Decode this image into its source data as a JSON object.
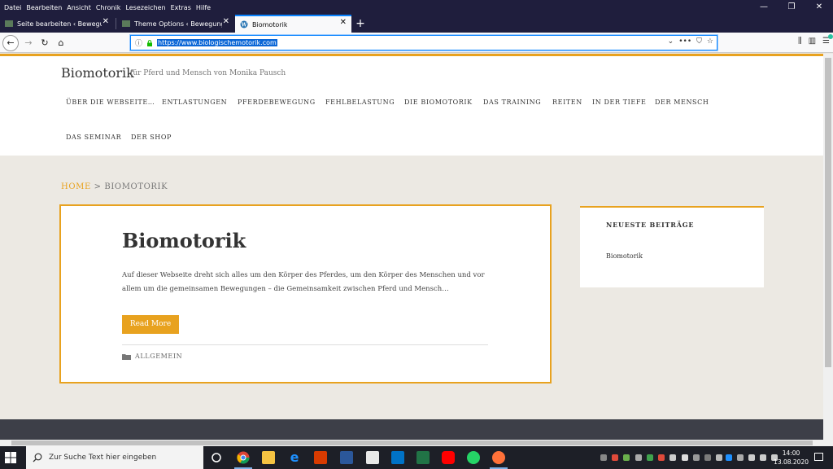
{
  "menubar": {
    "items": [
      "Datei",
      "Bearbeiten",
      "Ansicht",
      "Chronik",
      "Lesezeichen",
      "Extras",
      "Hilfe"
    ]
  },
  "window_controls": {
    "minimize": "—",
    "restore": "❐",
    "close": "✕"
  },
  "tabs": [
    {
      "label": "Seite bearbeiten ‹ BewegungsL…",
      "active": false
    },
    {
      "label": "Theme Options ‹ BewegungsLa…",
      "active": false
    },
    {
      "label": "Biomotorik",
      "active": true
    }
  ],
  "newtab_label": "+",
  "navbar": {
    "url": "https://www.biologischemotorik.com",
    "back": "←",
    "forward": "→",
    "reload": "↻",
    "home": "⌂",
    "overflow": "•••"
  },
  "site": {
    "title": "Biomotorik",
    "tagline": "für Pferd und Mensch von Monika Pausch",
    "nav": [
      "ÜBER DIE WEBSEITE…",
      "ENTLASTUNGEN",
      "PFERDEBEWEGUNG",
      "FEHLBELASTUNG",
      "DIE BIOMOTORIK",
      "DAS TRAINING",
      "REITEN",
      "IN DER TIEFE",
      "DER MENSCH",
      "DAS SEMINAR",
      "DER SHOP"
    ],
    "breadcrumb": {
      "home": "HOME",
      "separator": ">",
      "current": "BIOMOTORIK"
    },
    "post": {
      "title": "Biomotorik",
      "excerpt": "Auf dieser Webseite dreht sich alles um den Körper des Pferdes, um den Körper des Menschen und vor allem um die gemeinsamen Bewegungen – die Gemeinsamkeit zwischen Pferd und Mensch…",
      "read_more": "Read More",
      "category": "ALLGEMEIN"
    },
    "sidebar": {
      "widget_title": "NEUESTE BEITRÄGE",
      "items": [
        "Biomotorik"
      ]
    },
    "accent_color": "#e8a21f"
  },
  "taskbar": {
    "search_placeholder": "Zur Suche Text hier eingeben",
    "time": "14:00",
    "date": "13.08.2020"
  }
}
